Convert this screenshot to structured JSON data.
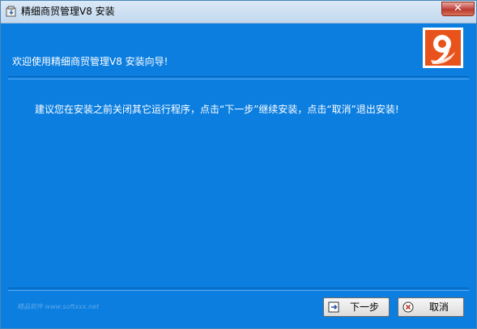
{
  "window": {
    "title": "精细商贸管理V8 安装"
  },
  "header": {
    "title": "欢迎使用精细商贸管理V8 安装向导!"
  },
  "body": {
    "message": "建议您在安装之前关闭其它运行程序，点击“下一步”继续安装，点击“取消”退出安装!"
  },
  "footer": {
    "text": "精品软件 www.softxxx.net"
  },
  "buttons": {
    "next_label": "下一步",
    "cancel_label": "取消"
  },
  "colors": {
    "background": "#0b7ee0",
    "logo_orange": "#e8531b",
    "close_red": "#c75050"
  },
  "icons": {
    "app": "installer-icon",
    "logo": "brand-swirl-logo",
    "close": "close-icon",
    "next": "next-icon",
    "cancel": "cancel-icon"
  }
}
